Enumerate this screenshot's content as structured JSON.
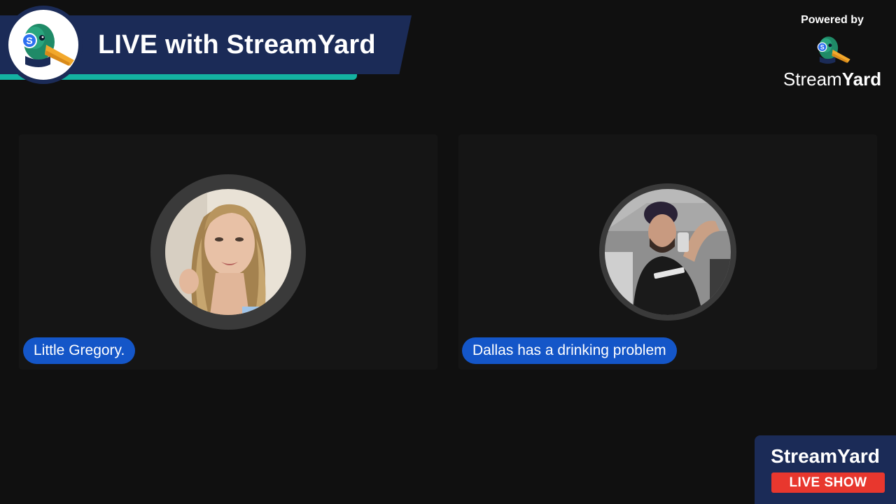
{
  "banner": {
    "title": "LIVE with StreamYard",
    "logo_icon": "duck-mascot-icon",
    "bar_color": "#1b2b57",
    "accent_color": "#14b3a2"
  },
  "powered_by": {
    "label": "Powered by",
    "brand_regular": "Stream",
    "brand_bold": "Yard",
    "logo_icon": "duck-mascot-icon"
  },
  "participants": [
    {
      "name": "Little Gregory.",
      "avatar": "woman-avatar-photo"
    },
    {
      "name": "Dallas has a drinking problem",
      "avatar": "man-selfie-avatar-photo"
    }
  ],
  "badge": {
    "brand": "StreamYard",
    "live_label": "LIVE SHOW",
    "live_color": "#e8372e"
  },
  "colors": {
    "background": "#101010",
    "tile": "#151515",
    "name_pill": "#1456c8"
  }
}
